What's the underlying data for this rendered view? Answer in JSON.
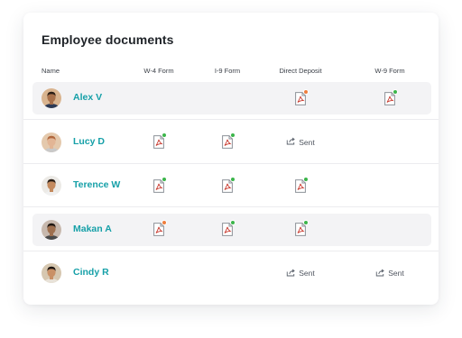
{
  "title": "Employee documents",
  "columns": {
    "name": "Name",
    "w4": "W-4 Form",
    "i9": "I-9 Form",
    "dd": "Direct Deposit",
    "w9": "W-9 Form"
  },
  "colors": {
    "accent": "#16a0a8",
    "complete": "#3bb54a",
    "attention": "#ef7d3c",
    "highlight": "#f3f3f5"
  },
  "sent_label": "Sent",
  "employees": [
    {
      "name": "Alex V",
      "highlight": true,
      "w4": "",
      "i9": "",
      "dd": "attention",
      "w9": "complete"
    },
    {
      "name": "Lucy D",
      "highlight": false,
      "w4": "complete",
      "i9": "complete",
      "dd": "sent",
      "w9": ""
    },
    {
      "name": "Terence W",
      "highlight": false,
      "w4": "complete",
      "i9": "complete",
      "dd": "complete",
      "w9": ""
    },
    {
      "name": "Makan A",
      "highlight": true,
      "w4": "attention",
      "i9": "complete",
      "dd": "complete",
      "w9": ""
    },
    {
      "name": "Cindy R",
      "highlight": false,
      "w4": "",
      "i9": "",
      "dd": "sent",
      "w9": "sent"
    }
  ]
}
